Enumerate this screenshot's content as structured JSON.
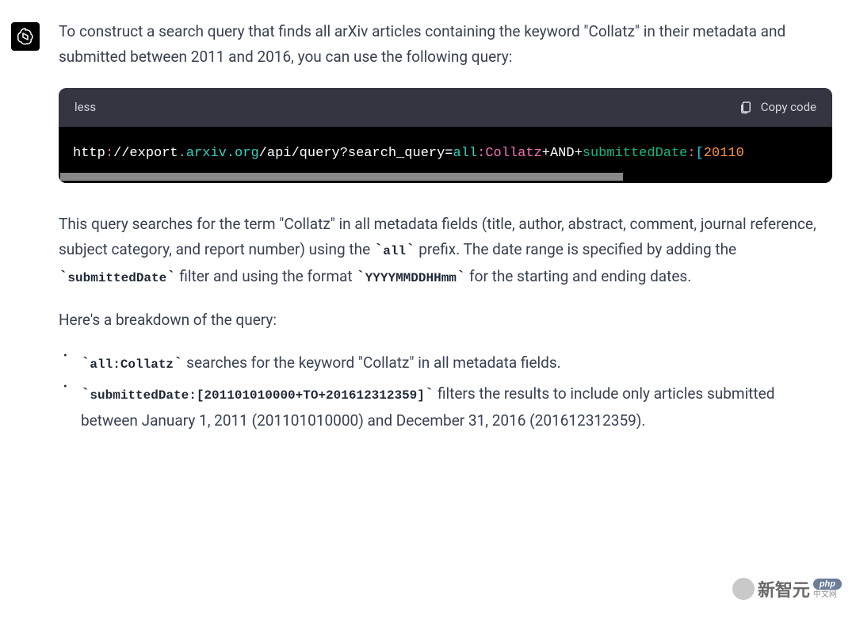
{
  "message": {
    "intro": "To construct a search query that finds all arXiv articles containing the keyword \"Collatz\" in their metadata and submitted between 2011 and 2016, you can use the following query:",
    "code_block": {
      "language": "less",
      "copy_label": "Copy code",
      "tokens": {
        "t1": "http",
        "t2": ":",
        "t3": "//export",
        "t4": ".arxiv",
        "t5": ".org",
        "t6": "/api/query?search_query=",
        "t7": "all",
        "t8": ":Collatz",
        "t9": "+",
        "t10": "AND",
        "t11": "+",
        "t12": "submittedDate",
        "t13": ":",
        "t14": "[",
        "t15": "20110"
      }
    },
    "explanation": {
      "part1": "This query searches for the term \"Collatz\" in all metadata fields (title, author, abstract, comment, journal reference, subject category, and report number) using the ",
      "code1": "all",
      "part2": " prefix. The date range is specified by adding the ",
      "code2": "submittedDate",
      "part3": " filter and using the format ",
      "code3": "YYYYMMDDHHmm",
      "part4": " for the starting and ending dates."
    },
    "breakdown_intro": "Here's a breakdown of the query:",
    "breakdown": [
      {
        "code": "all:Collatz",
        "text": " searches for the keyword \"Collatz\" in all metadata fields."
      },
      {
        "code": "submittedDate:[201101010000+TO+201612312359]",
        "text": " filters the results to include only articles submitted between January 1, 2011 (201101010000) and December 31, 2016 (201612312359)."
      }
    ]
  },
  "watermarks": {
    "right_text": "新智元",
    "right_sub": "中文网",
    "php": "php"
  }
}
